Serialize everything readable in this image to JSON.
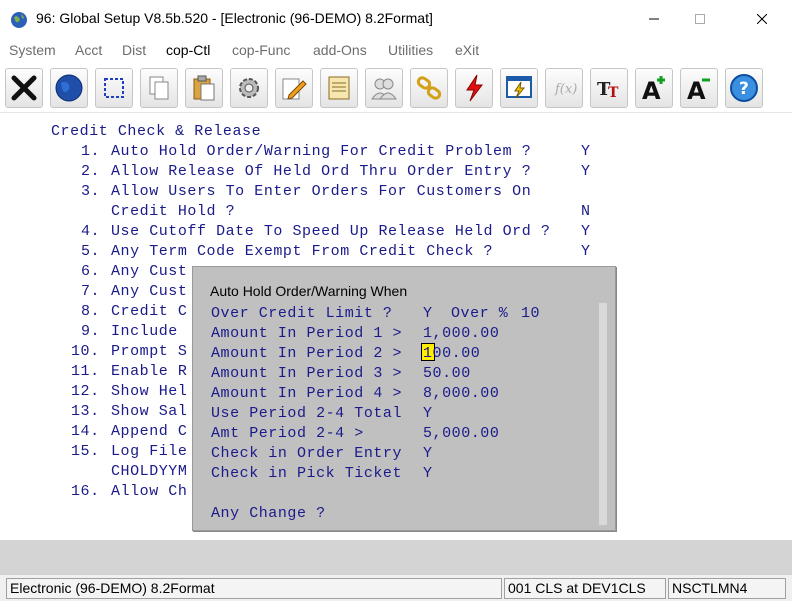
{
  "window": {
    "title": "96: Global Setup V8.5b.520 - [Electronic (96-DEMO) 8.2Format]"
  },
  "menu": {
    "items": [
      "System",
      "Acct",
      "Dist",
      "cop-Ctl",
      "cop-Func",
      "add-Ons",
      "Utilities",
      "eXit"
    ],
    "active": "cop-Ctl"
  },
  "toolbar": {
    "icons": [
      "exit-x-icon",
      "globe-icon",
      "select-box-icon",
      "copy-icon",
      "paste-icon",
      "gear-icon",
      "edit-pencil-icon",
      "notepad-icon",
      "users-icon",
      "chain-link-icon",
      "lightning-icon",
      "screen-lightning-icon",
      "function-icon",
      "font-tt-icon",
      "font-increase-icon",
      "font-decrease-icon",
      "help-icon"
    ]
  },
  "screen": {
    "heading": "Credit Check & Release",
    "lines": [
      {
        "num": "1.",
        "text": "Auto Hold Order/Warning For Credit Problem ?",
        "answer": "Y"
      },
      {
        "num": "2.",
        "text": "Allow Release Of Held Ord Thru Order Entry ?",
        "answer": "Y"
      },
      {
        "num": "3.",
        "text": "Allow Users To Enter Orders For Customers On",
        "answer": ""
      },
      {
        "num": "",
        "text": "Credit Hold ?",
        "answer": "N"
      },
      {
        "num": "4.",
        "text": "Use Cutoff Date To Speed Up Release Held Ord ?",
        "answer": "Y"
      },
      {
        "num": "5.",
        "text": "Any Term Code Exempt From Credit Check ?",
        "answer": "Y"
      },
      {
        "num": "6.",
        "text": "Any Cust",
        "answer": ""
      },
      {
        "num": "7.",
        "text": "Any Cust",
        "answer": ""
      },
      {
        "num": "8.",
        "text": "Credit C",
        "answer": ""
      },
      {
        "num": "9.",
        "text": "Include",
        "answer": ""
      },
      {
        "num": "10.",
        "text": "Prompt S",
        "answer": ""
      },
      {
        "num": "11.",
        "text": "Enable R",
        "answer": ""
      },
      {
        "num": "12.",
        "text": "Show Hel",
        "answer": ""
      },
      {
        "num": "13.",
        "text": "Show Sal",
        "answer": ""
      },
      {
        "num": "14.",
        "text": "Append C",
        "answer": ""
      },
      {
        "num": "15.",
        "text": "Log File",
        "answer": ""
      },
      {
        "num": "",
        "text": "CHOLDYYM",
        "answer": ""
      },
      {
        "num": "16.",
        "text": "Allow Ch",
        "answer": ""
      }
    ]
  },
  "dialog": {
    "title": "Auto Hold Order/Warning When",
    "rows": [
      {
        "label": "Over Credit Limit ?",
        "value": "Y",
        "extra_label": "Over %",
        "extra_value": "10"
      },
      {
        "label": "Amount In Period 1 >",
        "value": "1,000.00"
      },
      {
        "label": "Amount In Period 2 >",
        "value": "100.00"
      },
      {
        "label": "Amount In Period 3 >",
        "value": "50.00"
      },
      {
        "label": "Amount In Period 4 >",
        "value": "8,000.00"
      },
      {
        "label": "Use Period 2-4 Total",
        "value": "Y"
      },
      {
        "label": "Amt Period 2-4 >",
        "value": "5,000.00"
      },
      {
        "label": "Check in Order Entry",
        "value": "Y"
      },
      {
        "label": "Check in Pick Ticket",
        "value": "Y"
      }
    ],
    "prompt": "Any Change ?"
  },
  "status": {
    "left": "Electronic (96-DEMO) 8.2Format",
    "middle": "001 CLS at DEV1CLS",
    "right": "NSCTLMN4"
  },
  "colors": {
    "terminal_text": "#1a1a8a",
    "dialog_bg": "#c0c0c0",
    "cursor": "#ffee00"
  }
}
